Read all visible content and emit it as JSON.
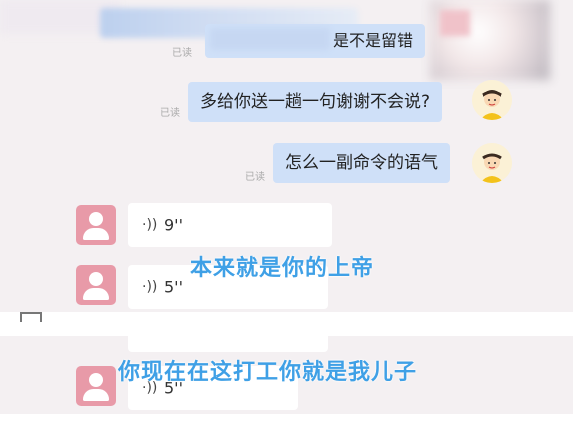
{
  "chat": {
    "top_partial_text": "是不是留错",
    "read_label": "已读",
    "sent": [
      {
        "text": "多给你送一趟一句谢谢不会说?"
      },
      {
        "text": "怎么一副命令的语气"
      }
    ],
    "voice": [
      {
        "icon": "·))",
        "duration": "9''"
      },
      {
        "icon": "·))",
        "duration": "5''"
      },
      {
        "icon": "·))",
        "duration": "5''"
      }
    ]
  },
  "subtitles": {
    "line1": "本来就是你的上帝",
    "line2": "你现在在这打工你就是我儿子"
  },
  "colors": {
    "sent_bubble": "#cfe0f8",
    "subtitle": "#3fa0e6",
    "avatar_pink": "#e89aa8",
    "courier_uniform": "#f3c21b"
  },
  "icons": {
    "courier_avatar": "courier-avatar-icon",
    "user_avatar": "default-user-avatar-icon",
    "voice": "voice-wave-icon"
  }
}
